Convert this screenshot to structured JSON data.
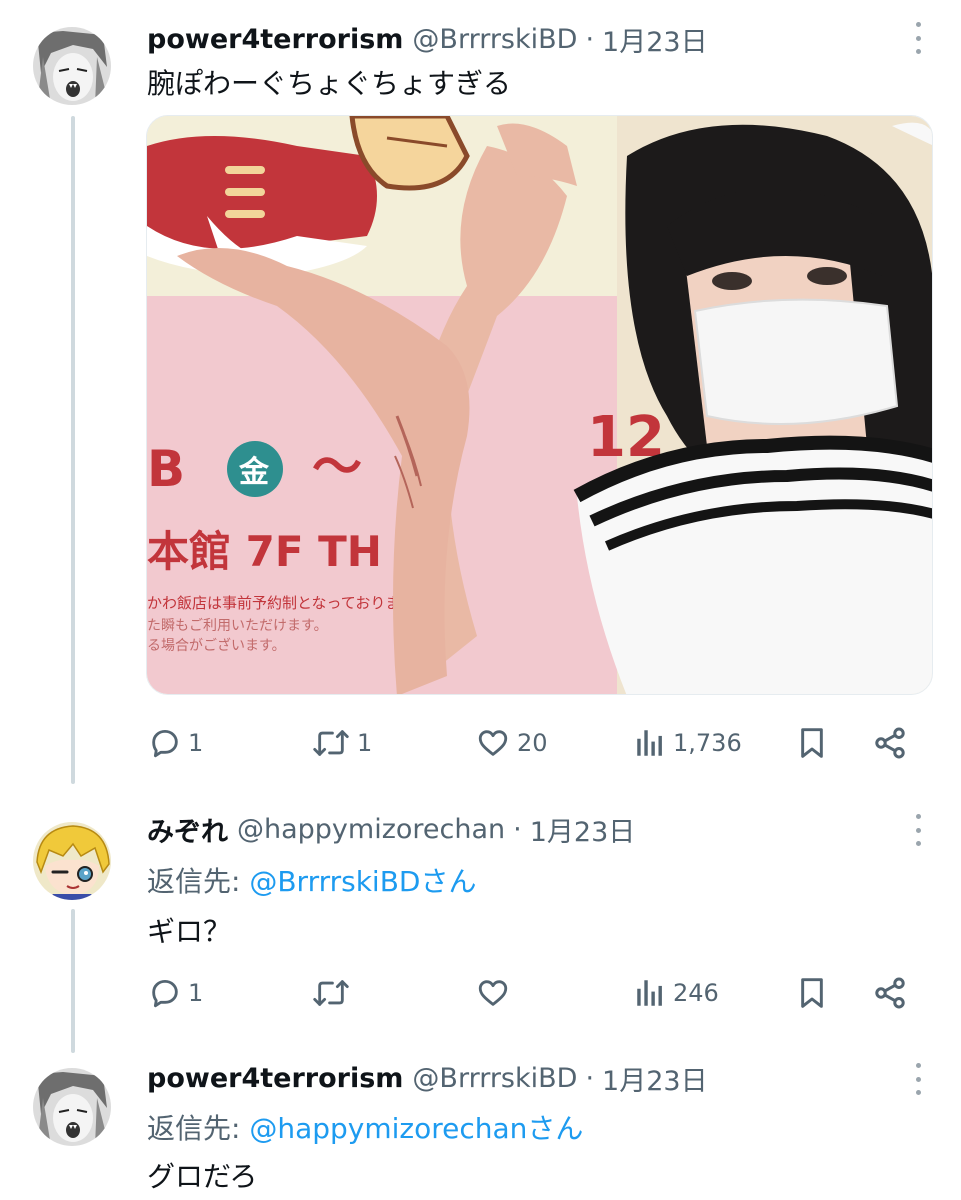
{
  "tweets": [
    {
      "display_name": "power4terrorism",
      "handle": "@BrrrrskiBD",
      "separator": "·",
      "date": "1月23日",
      "text": "腕ぽわーぐちょぐちょすぎる",
      "actions": {
        "replies": "1",
        "retweets": "1",
        "likes": "20",
        "views": "1,736"
      }
    },
    {
      "display_name": "みぞれ",
      "handle": "@happymizorechan",
      "separator": "·",
      "date": "1月23日",
      "reply_prefix": "返信先: ",
      "reply_mention": "@BrrrrskiBDさん",
      "text": "ギロ？",
      "actions": {
        "replies": "1",
        "retweets": "",
        "likes": "",
        "views": "246"
      }
    },
    {
      "display_name": "power4terrorism",
      "handle": "@BrrrrskiBD",
      "separator": "·",
      "date": "1月23日",
      "reply_prefix": "返信先: ",
      "reply_mention": "@happymizorechanさん",
      "text": "グロだろ"
    }
  ],
  "icons": {
    "reply": "reply-icon",
    "retweet": "retweet-icon",
    "like": "heart-icon",
    "views": "views-icon",
    "bookmark": "bookmark-icon",
    "share": "share-icon",
    "more": "more-dots-icon"
  },
  "colors": {
    "link": "#1d9bf0",
    "secondary_text": "#536471",
    "thread_line": "#cfd9de"
  }
}
